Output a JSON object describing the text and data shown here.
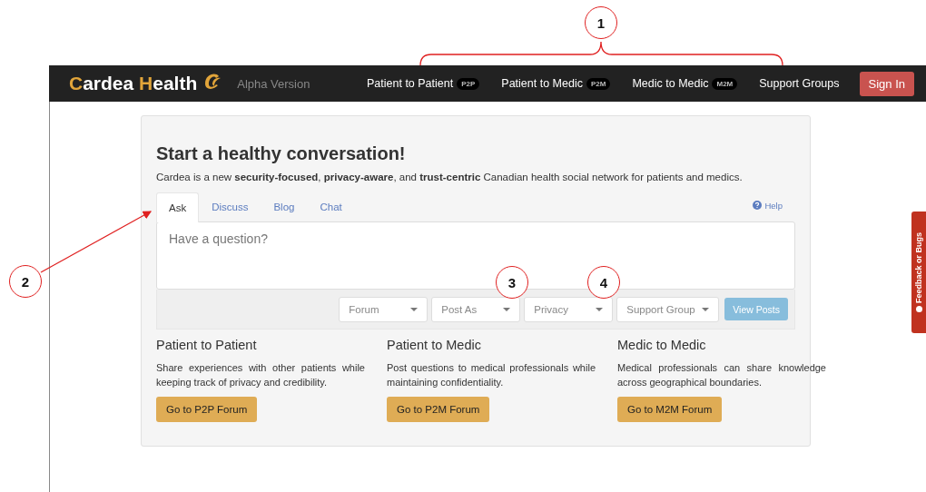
{
  "brand": {
    "name": "Cardea Health",
    "version": "Alpha Version"
  },
  "nav": [
    {
      "label": "Patient to Patient",
      "badge": "P2P"
    },
    {
      "label": "Patient to Medic",
      "badge": "P2M"
    },
    {
      "label": "Medic to Medic",
      "badge": "M2M"
    },
    {
      "label": "Support Groups"
    }
  ],
  "sign_in": "Sign In",
  "hero": {
    "title": "Start a healthy conversation!",
    "intro": "Cardea is a new **security-focused**, **privacy-aware**, and **trust-centric** Canadian health social network for patients and medics."
  },
  "tabs": [
    {
      "label": "Ask",
      "selected": true
    },
    {
      "label": "Discuss",
      "selected": false
    },
    {
      "label": "Blog",
      "selected": false
    },
    {
      "label": "Chat",
      "selected": false
    }
  ],
  "help": "Help",
  "question": {
    "placeholder": "Have a question?"
  },
  "filters": [
    {
      "placeholder": "Forum"
    },
    {
      "placeholder": "Post As"
    },
    {
      "placeholder": "Privacy"
    },
    {
      "placeholder": "Support Group"
    }
  ],
  "view_posts": "View Posts",
  "sections": [
    {
      "title": "Patient to Patient",
      "text": "Share experiences with other patients while keeping track of privacy and credibility.",
      "button": "Go to P2P Forum"
    },
    {
      "title": "Patient to Medic",
      "text": "Post questions to medical professionals while maintaining confidentiality.",
      "button": "Go to P2M Forum"
    },
    {
      "title": "Medic to Medic",
      "text": "Medical professionals can share knowledge across geographical boundaries.",
      "button": "Go to M2M Forum"
    }
  ],
  "feedback_tab": "Feedback or Bugs",
  "callouts": [
    {
      "label": "1"
    },
    {
      "label": "2"
    },
    {
      "label": "3"
    },
    {
      "label": "4"
    }
  ]
}
